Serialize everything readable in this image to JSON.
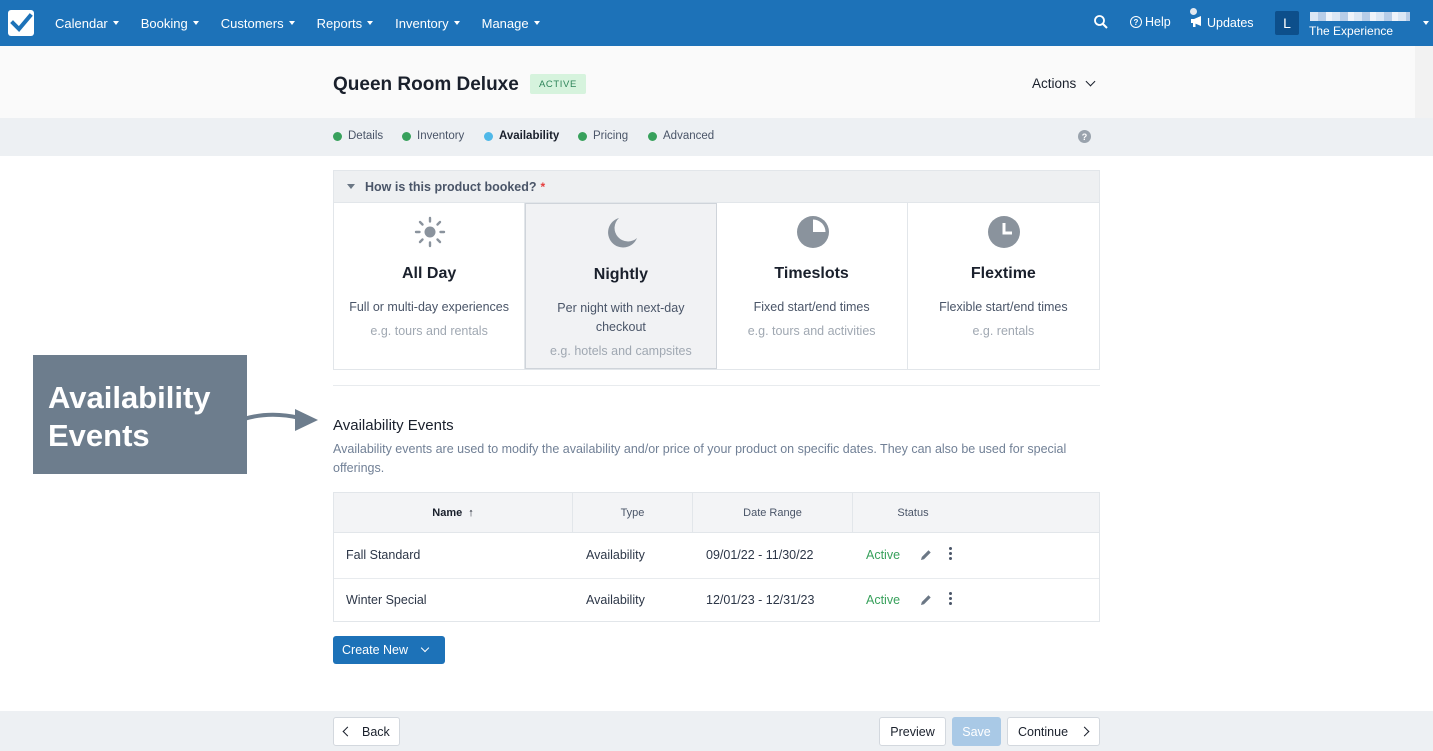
{
  "nav": {
    "items": [
      {
        "label": "Calendar"
      },
      {
        "label": "Booking"
      },
      {
        "label": "Customers"
      },
      {
        "label": "Reports"
      },
      {
        "label": "Inventory"
      },
      {
        "label": "Manage"
      }
    ],
    "help_label": "Help",
    "updates_label": "Updates",
    "avatar_initial": "L",
    "account_name": "The Experience"
  },
  "product": {
    "title": "Queen Room Deluxe",
    "status": "ACTIVE",
    "actions_label": "Actions"
  },
  "steps": [
    {
      "label": "Details"
    },
    {
      "label": "Inventory"
    },
    {
      "label": "Availability"
    },
    {
      "label": "Pricing"
    },
    {
      "label": "Advanced"
    }
  ],
  "booking": {
    "question": "How is this product booked?",
    "required_mark": "*",
    "options": [
      {
        "icon": "sun-icon",
        "title": "All Day",
        "desc": "Full or multi-day experiences",
        "example": "e.g. tours and rentals"
      },
      {
        "icon": "moon-icon",
        "title": "Nightly",
        "desc": "Per night with next-day checkout",
        "example": "e.g. hotels and campsites"
      },
      {
        "icon": "pie-timeslot-icon",
        "title": "Timeslots",
        "desc": "Fixed start/end times",
        "example": "e.g. tours and activities"
      },
      {
        "icon": "clock-icon",
        "title": "Flextime",
        "desc": "Flexible start/end times",
        "example": "e.g. rentals"
      }
    ]
  },
  "callout": {
    "line1": "Availability",
    "line2": "Events"
  },
  "events": {
    "title": "Availability Events",
    "description": "Availability events are used to modify the availability and/or price of your product on specific dates. They can also be used for special offerings.",
    "columns": {
      "name": "Name",
      "type": "Type",
      "date_range": "Date Range",
      "status": "Status"
    },
    "sort_indicator": "↑",
    "rows": [
      {
        "name": "Fall Standard",
        "type": "Availability",
        "date_range": "09/01/22 - 11/30/22",
        "status": "Active"
      },
      {
        "name": "Winter Special",
        "type": "Availability",
        "date_range": "12/01/23 - 12/31/23",
        "status": "Active"
      }
    ],
    "create_label": "Create New"
  },
  "footer": {
    "back_label": "Back",
    "preview_label": "Preview",
    "save_label": "Save",
    "continue_label": "Continue"
  },
  "colors": {
    "nav_bg": "#1d72b8",
    "active_green": "#38a15c",
    "current_step_blue": "#4fb8e8",
    "callout_bg": "#6d7d8d"
  }
}
